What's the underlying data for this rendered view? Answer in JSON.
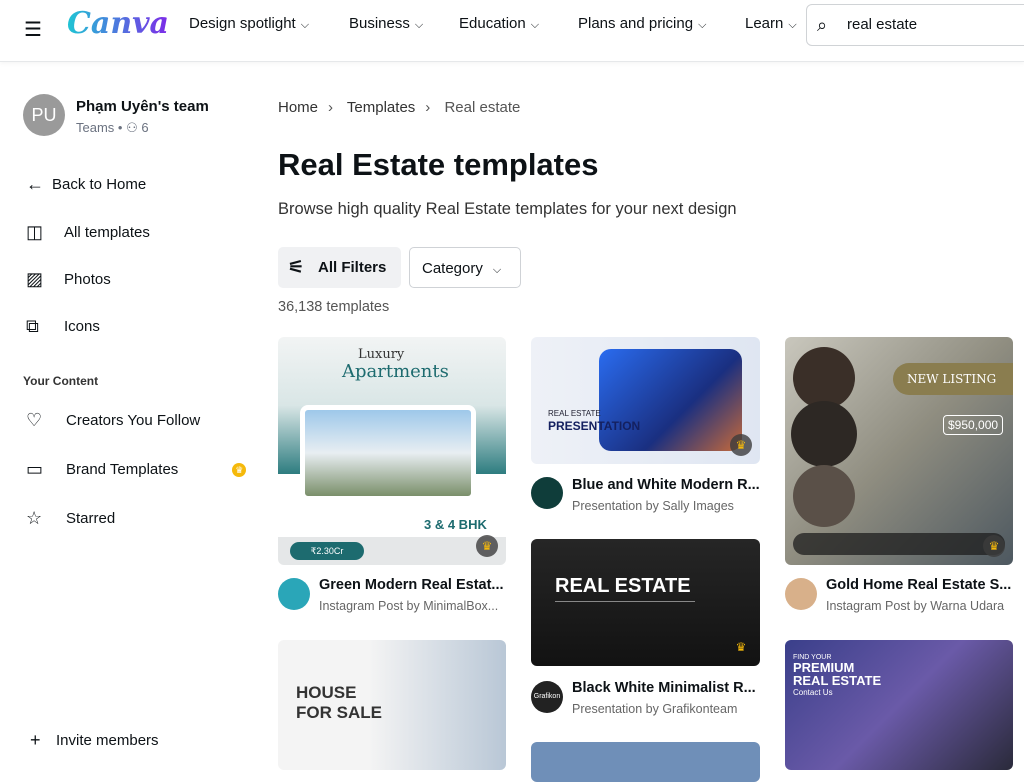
{
  "header": {
    "logo": "Canva",
    "nav": [
      {
        "label": "Design spotlight"
      },
      {
        "label": "Business"
      },
      {
        "label": "Education"
      },
      {
        "label": "Plans and pricing"
      },
      {
        "label": "Learn"
      }
    ],
    "search_value": "real estate"
  },
  "sidebar": {
    "avatar_initials": "PU",
    "team_name": "Phạm Uyên's team",
    "team_sub": "Teams • ⚇ 6",
    "items": [
      {
        "label": "Back to Home",
        "icon": "arrow-left"
      },
      {
        "label": "All templates",
        "icon": "layout"
      },
      {
        "label": "Photos",
        "icon": "image"
      },
      {
        "label": "Icons",
        "icon": "shapes"
      }
    ],
    "section": "Your Content",
    "content_items": [
      {
        "label": "Creators You Follow",
        "icon": "heart"
      },
      {
        "label": "Brand Templates",
        "icon": "brand"
      },
      {
        "label": "Starred",
        "icon": "star"
      }
    ],
    "invite": "Invite members"
  },
  "breadcrumb": [
    "Home",
    "Templates",
    "Real estate"
  ],
  "title": "Real Estate templates",
  "description": "Browse high quality Real Estate templates for your next design",
  "filters": {
    "all": "All Filters",
    "category": "Category"
  },
  "count": "36,138 templates",
  "templates": [
    {
      "title": "Green Modern Real Estat...",
      "sub": "Instagram Post by MinimalBox...",
      "t1": "Luxury",
      "t2": "Apartments",
      "t3": "3 & 4 BHK",
      "t4": "₹2.30Cr"
    },
    {
      "title": "Blue and White Modern R...",
      "sub": "Presentation by Sally Images",
      "t1": "REAL ESTATE",
      "t2": "PRESENTATION"
    },
    {
      "title": "Gold Home Real Estate S...",
      "sub": "Instagram Post by Warna Udara",
      "t1": "NEW LISTING",
      "t2": "$950,000"
    },
    {
      "title": "Black White Minimalist R...",
      "sub": "Presentation by Grafikonteam",
      "t1": "REAL ESTATE",
      "avatar": "Grafikon"
    },
    {
      "t1": "HOUSE",
      "t2": "FOR SALE"
    },
    {
      "t1": "FIND YOUR",
      "t2": "PREMIUM",
      "t3": "REAL ESTATE",
      "t4": "Contact Us"
    }
  ],
  "colors": {
    "accent": "#7d2ae8",
    "teal": "#1d6b6f",
    "gold": "#8a7d4f"
  }
}
